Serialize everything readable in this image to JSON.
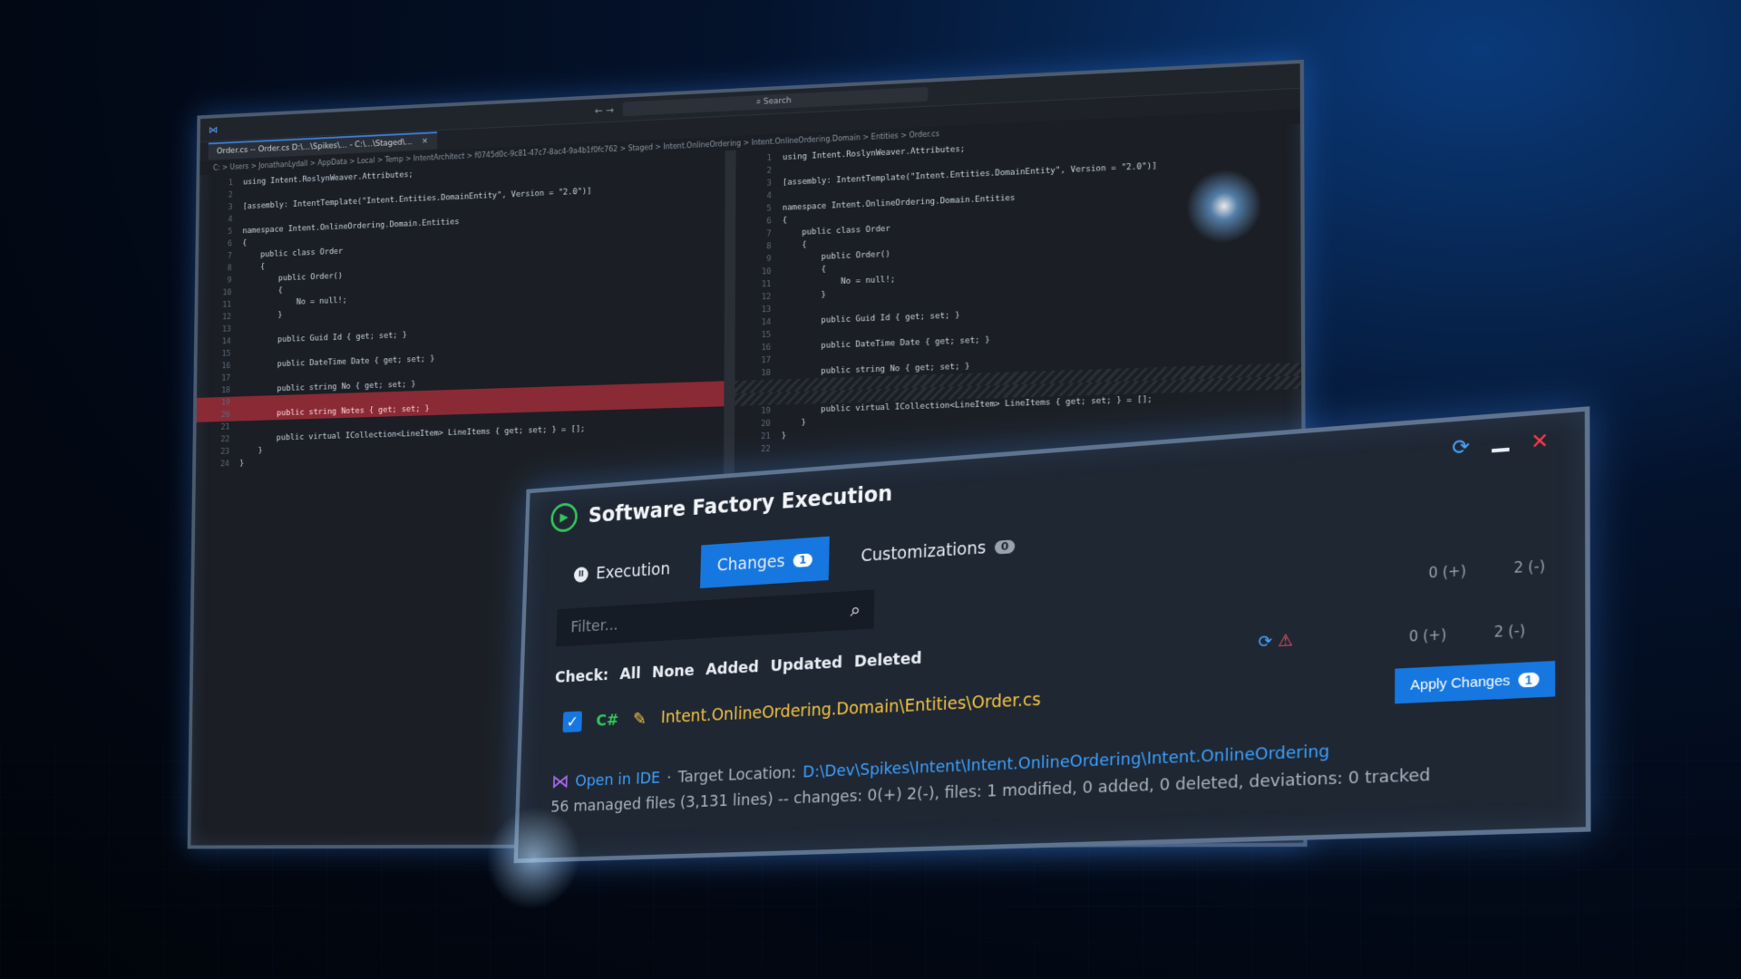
{
  "ide": {
    "search_label": "Search",
    "tab_label": "Order.cs -- Order.cs",
    "tab_path": "D:\\...\\Spikes\\... - C:\\...\\Staged\\...",
    "breadcrumb": "C: > Users > JonathanLydall > AppData > Local > Temp > IntentArchitect > f0745d0c-9c81-47c7-8ac4-9a4b1f0fc762 > Staged > Intent.OnlineOrdering > Intent.OnlineOrdering.Domain > Entities > Order.cs",
    "left_lines": [
      {
        "n": "1",
        "t": "using Intent.RoslynWeaver.Attributes;"
      },
      {
        "n": "2",
        "t": ""
      },
      {
        "n": "3",
        "t": "[assembly: IntentTemplate(\"Intent.Entities.DomainEntity\", Version = \"2.0\")]"
      },
      {
        "n": "4",
        "t": ""
      },
      {
        "n": "5",
        "t": "namespace Intent.OnlineOrdering.Domain.Entities"
      },
      {
        "n": "6",
        "t": "{"
      },
      {
        "n": "7",
        "t": "    public class Order"
      },
      {
        "n": "8",
        "t": "    {"
      },
      {
        "n": "9",
        "t": "        public Order()"
      },
      {
        "n": "10",
        "t": "        {"
      },
      {
        "n": "11",
        "t": "            No = null!;"
      },
      {
        "n": "12",
        "t": "        }"
      },
      {
        "n": "13",
        "t": ""
      },
      {
        "n": "14",
        "t": "        public Guid Id { get; set; }"
      },
      {
        "n": "15",
        "t": ""
      },
      {
        "n": "16",
        "t": "        public DateTime Date { get; set; }"
      },
      {
        "n": "17",
        "t": ""
      },
      {
        "n": "18",
        "t": "        public string No { get; set; }"
      },
      {
        "n": "19",
        "t": ""
      },
      {
        "n": "20",
        "t": "        public string Notes { get; set; }"
      },
      {
        "n": "21",
        "t": ""
      },
      {
        "n": "22",
        "t": "        public virtual ICollection<LineItem> LineItems { get; set; } = [];"
      },
      {
        "n": "23",
        "t": "    }"
      },
      {
        "n": "24",
        "t": "}"
      }
    ],
    "right_lines": [
      {
        "n": "1",
        "t": "using Intent.RoslynWeaver.Attributes;"
      },
      {
        "n": "2",
        "t": ""
      },
      {
        "n": "3",
        "t": "[assembly: IntentTemplate(\"Intent.Entities.DomainEntity\", Version = \"2.0\")]"
      },
      {
        "n": "4",
        "t": ""
      },
      {
        "n": "5",
        "t": "namespace Intent.OnlineOrdering.Domain.Entities"
      },
      {
        "n": "6",
        "t": "{"
      },
      {
        "n": "7",
        "t": "    public class Order"
      },
      {
        "n": "8",
        "t": "    {"
      },
      {
        "n": "9",
        "t": "        public Order()"
      },
      {
        "n": "10",
        "t": "        {"
      },
      {
        "n": "11",
        "t": "            No = null!;"
      },
      {
        "n": "12",
        "t": "        }"
      },
      {
        "n": "13",
        "t": ""
      },
      {
        "n": "14",
        "t": "        public Guid Id { get; set; }"
      },
      {
        "n": "15",
        "t": ""
      },
      {
        "n": "16",
        "t": "        public DateTime Date { get; set; }"
      },
      {
        "n": "17",
        "t": ""
      },
      {
        "n": "18",
        "t": "        public string No { get; set; }"
      },
      {
        "n": "",
        "t": ""
      },
      {
        "n": "",
        "t": ""
      },
      {
        "n": "19",
        "t": "        public virtual ICollection<LineItem> LineItems { get; set; } = [];"
      },
      {
        "n": "20",
        "t": "    }"
      },
      {
        "n": "21",
        "t": "}"
      },
      {
        "n": "22",
        "t": ""
      }
    ]
  },
  "panel": {
    "title": "Software Factory Execution",
    "tabs": {
      "execution": "Execution",
      "changes": "Changes",
      "changes_count": "1",
      "customizations": "Customizations",
      "customizations_count": "0"
    },
    "filter": {
      "placeholder": "Filter..."
    },
    "stats_top": {
      "added": "0 (+)",
      "removed": "2 (-)"
    },
    "stats_row": {
      "added": "0 (+)",
      "removed": "2 (-)"
    },
    "check": {
      "label": "Check:",
      "all": "All",
      "none": "None",
      "added": "Added",
      "updated": "Updated",
      "deleted": "Deleted"
    },
    "file": {
      "lang": "C#",
      "path": "Intent.OnlineOrdering.Domain\\Entities\\Order.cs"
    },
    "apply": {
      "label": "Apply Changes",
      "count": "1"
    },
    "footer": {
      "open_ide": "Open in IDE",
      "separator": "·",
      "target_label": "Target Location:",
      "target_path": "D:\\Dev\\Spikes\\Intent\\Intent.OnlineOrdering\\Intent.OnlineOrdering",
      "summary": "56 managed files (3,131 lines) -- changes: 0(+) 2(-), files: 1 modified, 0 added, 0 deleted, deviations: 0 tracked"
    }
  },
  "colors": {
    "accent": "#1677e0",
    "play_green": "#34c759",
    "path_yellow": "#f5c542",
    "close_red": "#ff3b4a",
    "link_blue": "#3da1ff"
  }
}
